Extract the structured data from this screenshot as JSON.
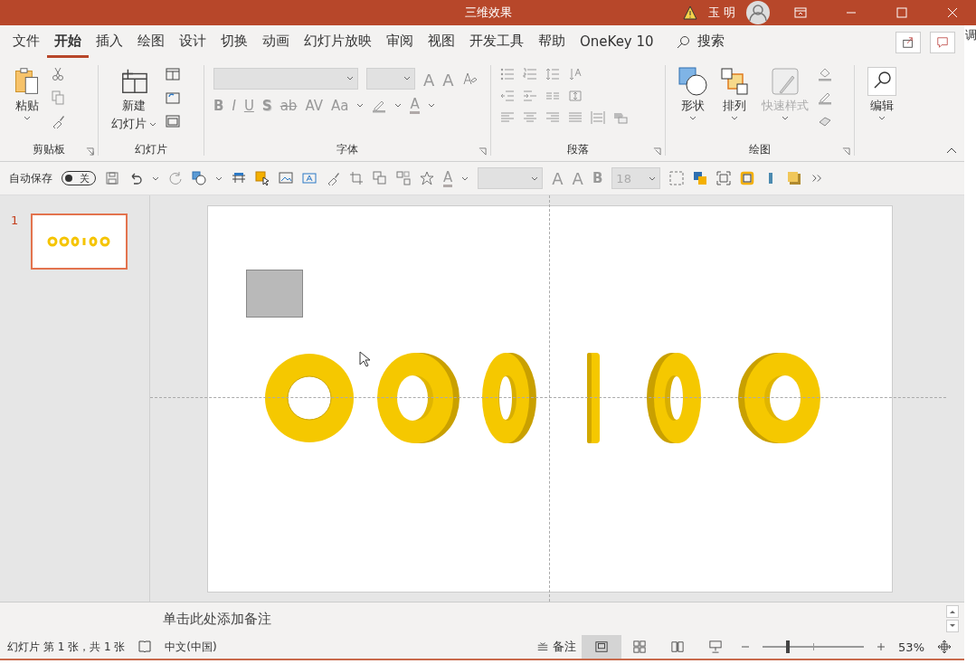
{
  "window": {
    "title": "三维效果",
    "user": "玉 明"
  },
  "menu_tabs": [
    {
      "label": "文件",
      "selected": false
    },
    {
      "label": "开始",
      "selected": true
    },
    {
      "label": "插入",
      "selected": false
    },
    {
      "label": "绘图",
      "selected": false
    },
    {
      "label": "设计",
      "selected": false
    },
    {
      "label": "切换",
      "selected": false
    },
    {
      "label": "动画",
      "selected": false
    },
    {
      "label": "幻灯片放映",
      "selected": false
    },
    {
      "label": "审阅",
      "selected": false
    },
    {
      "label": "视图",
      "selected": false
    },
    {
      "label": "开发工具",
      "selected": false
    },
    {
      "label": "帮助",
      "selected": false
    },
    {
      "label": "OneKey 10",
      "selected": false
    }
  ],
  "search": {
    "label": "搜索"
  },
  "ribbon": {
    "groups": [
      {
        "label": "剪贴板",
        "launcher": true,
        "buttons": [
          {
            "label": "粘贴",
            "disabled": false
          }
        ]
      },
      {
        "label": "幻灯片",
        "launcher": false,
        "buttons": [
          {
            "label": "新建",
            "label2": "幻灯片",
            "disabled": false
          }
        ]
      },
      {
        "label": "字体",
        "launcher": true
      },
      {
        "label": "段落",
        "launcher": true
      },
      {
        "label": "绘图",
        "launcher": true,
        "buttons": [
          {
            "label": "形状",
            "disabled": false
          },
          {
            "label": "排列",
            "disabled": false
          },
          {
            "label": "快速样式",
            "disabled": true
          }
        ]
      },
      {
        "buttons": [
          {
            "label": "编辑",
            "disabled": false
          }
        ]
      }
    ],
    "font_size_buttons": [
      "A",
      "A"
    ],
    "font_style_buttons": [
      "B",
      "I",
      "U",
      "S",
      "ab",
      "AV",
      "Aa"
    ],
    "font_color_buttons": [
      "A"
    ]
  },
  "quick_access": {
    "autosave_label": "自动保存",
    "autosave_on": false,
    "autosave_state": "关",
    "grow_buttons": [
      "A",
      "A"
    ],
    "bold_button": "B",
    "font_color": "A",
    "font_size": "18"
  },
  "thumbnails": [
    {
      "number": "1",
      "selected": true
    }
  ],
  "notes": {
    "placeholder": "单击此处添加备注"
  },
  "status_bar": {
    "slide_info": "幻灯片 第 1 张，共 1 张",
    "language": "中文(中国)",
    "notes_button": "备注",
    "views": [
      {
        "selected": true
      },
      {
        "selected": false
      },
      {
        "selected": false
      },
      {
        "selected": false
      }
    ],
    "zoom": {
      "level": 0.25,
      "reading": "53%"
    }
  },
  "background": {
    "top_text": "调"
  }
}
